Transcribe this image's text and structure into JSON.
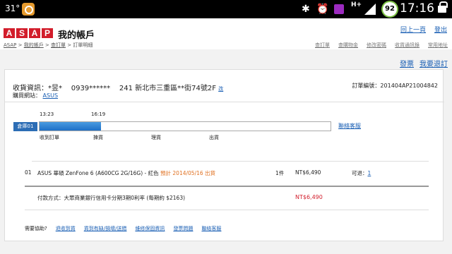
{
  "statusbar": {
    "temp": "31°",
    "battery": "92",
    "net": "H+",
    "time": "17:16"
  },
  "header": {
    "logo_letters": [
      "A",
      "S",
      "A",
      "P"
    ],
    "title": "我的帳戶",
    "links": [
      "回上一頁",
      "登出"
    ]
  },
  "breadcrumb": [
    "ASAP",
    "我的帳戶",
    "查訂單",
    "訂單明細"
  ],
  "subnav": [
    "查訂單",
    "查購物金",
    "修改密碼",
    "收貨通訊錄",
    "常用地址"
  ],
  "actions": [
    "發票",
    "我要退訂"
  ],
  "order": {
    "recipient_label": "收貨資訊：",
    "recipient_name": "*昱*",
    "phone": "0939******",
    "address": "241 新北市三重區**街74號2F",
    "edit_label": "改",
    "order_no": "訂單編號：201404AP21004842",
    "site_label": "購買網站：",
    "site_name": "ASUS"
  },
  "tracking": {
    "warehouse_label": "倉庫01",
    "progress_pct": 21,
    "times": [
      "13:23",
      "16:19"
    ],
    "stages": [
      "收到訂單",
      "揀貨",
      "理貨",
      "出貨"
    ],
    "contact_label": "聯絡客服"
  },
  "item": {
    "index": "01",
    "name": "ASUS 華碩 ZenFone 6 (A600CG 2G/16G) - 紅色",
    "eta": "預計 2014/05/16 出貨",
    "qty": "1件",
    "price": "NT$6,490",
    "return_label": "可退：",
    "return_count": "1"
  },
  "payment": {
    "method": "付款方式：大眾商業銀行信用卡分期3期0利率 (每期約 $2163)",
    "total": "NT$6,490"
  },
  "help": {
    "label": "需要協助?",
    "links": [
      "退收到貨",
      "貨到有缺/損壞/送錯",
      "維修保固資訊",
      "發票問題",
      "聯絡客服"
    ]
  }
}
